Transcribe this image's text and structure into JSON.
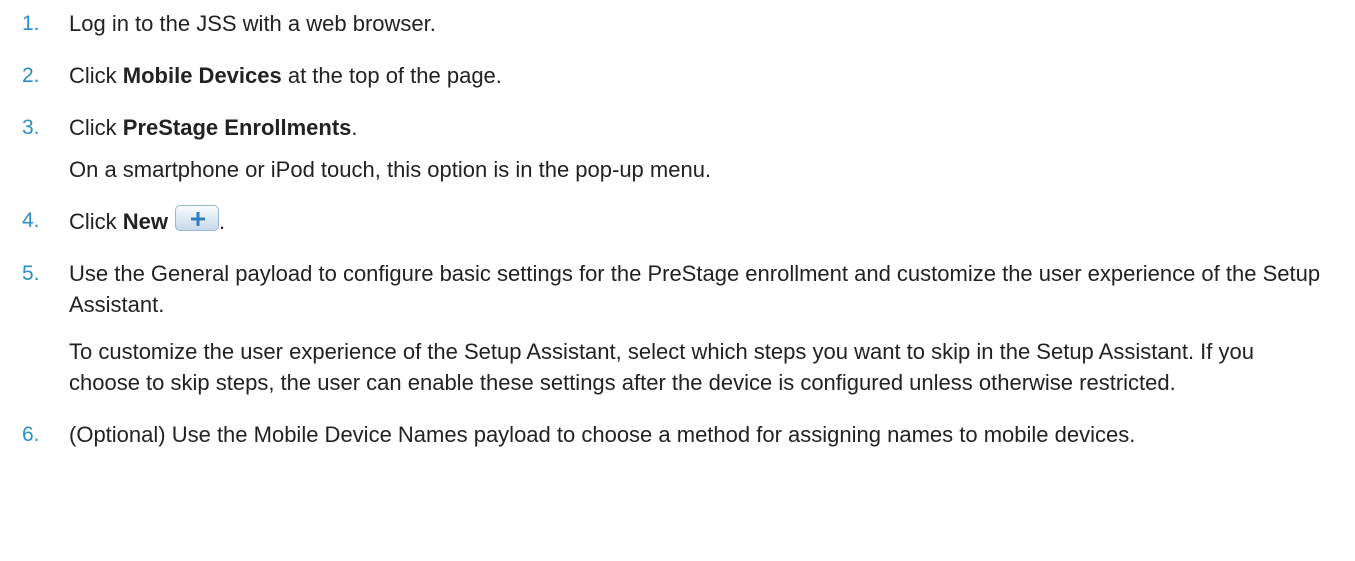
{
  "steps": [
    {
      "number": "1.",
      "text": "Log in to the JSS with a web browser."
    },
    {
      "number": "2.",
      "before": "Click ",
      "bold": "Mobile Devices",
      "after": " at the top of the page."
    },
    {
      "number": "3.",
      "before": "Click ",
      "bold": "PreStage Enrollments",
      "after": ".",
      "note": "On a smartphone or iPod touch, this option is in the pop-up menu."
    },
    {
      "number": "4.",
      "before": "Click ",
      "bold": "New",
      "after": ".",
      "icon": "plus-icon"
    },
    {
      "number": "5.",
      "text": "Use the General payload to configure basic settings for the PreStage enrollment and customize the user experience of the Setup Assistant.",
      "note": "To customize the user experience of the Setup Assistant, select which steps you want to skip in the Setup Assistant. If you choose to skip steps, the user can enable these settings after the device is configured unless otherwise restricted."
    },
    {
      "number": "6.",
      "text": "(Optional) Use the Mobile Device Names payload to choose a method for assigning names to mobile devices."
    }
  ],
  "colors": {
    "step_number": "#2b8fc4",
    "body_text": "#222222",
    "button_icon": "#2f7fbf"
  }
}
